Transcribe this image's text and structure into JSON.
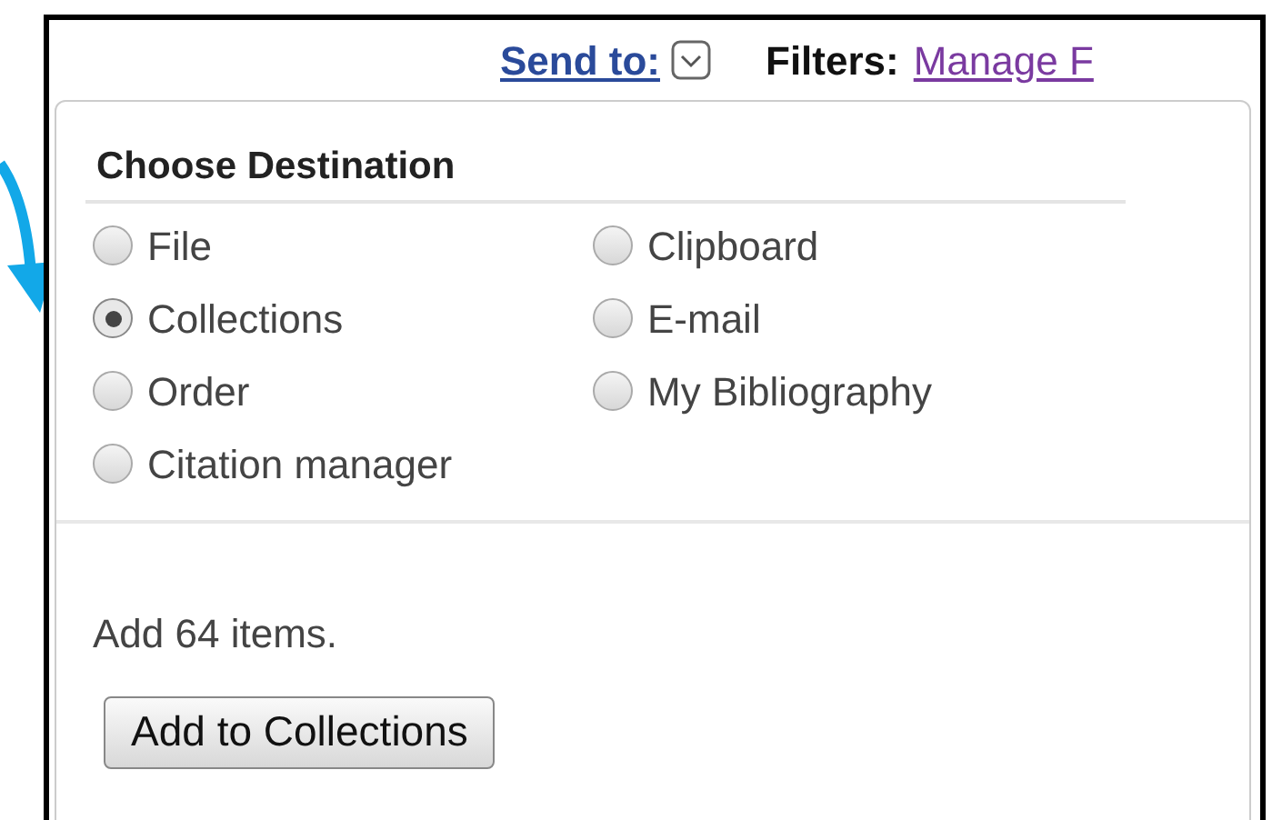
{
  "toolbar": {
    "send_to": "Send to:",
    "filters_label": "Filters:",
    "filters_link": "Manage F"
  },
  "panel": {
    "title": "Choose Destination",
    "options": [
      {
        "label": "File",
        "selected": false
      },
      {
        "label": "Clipboard",
        "selected": false
      },
      {
        "label": "Collections",
        "selected": true
      },
      {
        "label": "E-mail",
        "selected": false
      },
      {
        "label": "Order",
        "selected": false
      },
      {
        "label": "My Bibliography",
        "selected": false
      },
      {
        "label": "Citation manager",
        "selected": false
      }
    ],
    "message": "Add 64 items.",
    "button": "Add to Collections"
  }
}
